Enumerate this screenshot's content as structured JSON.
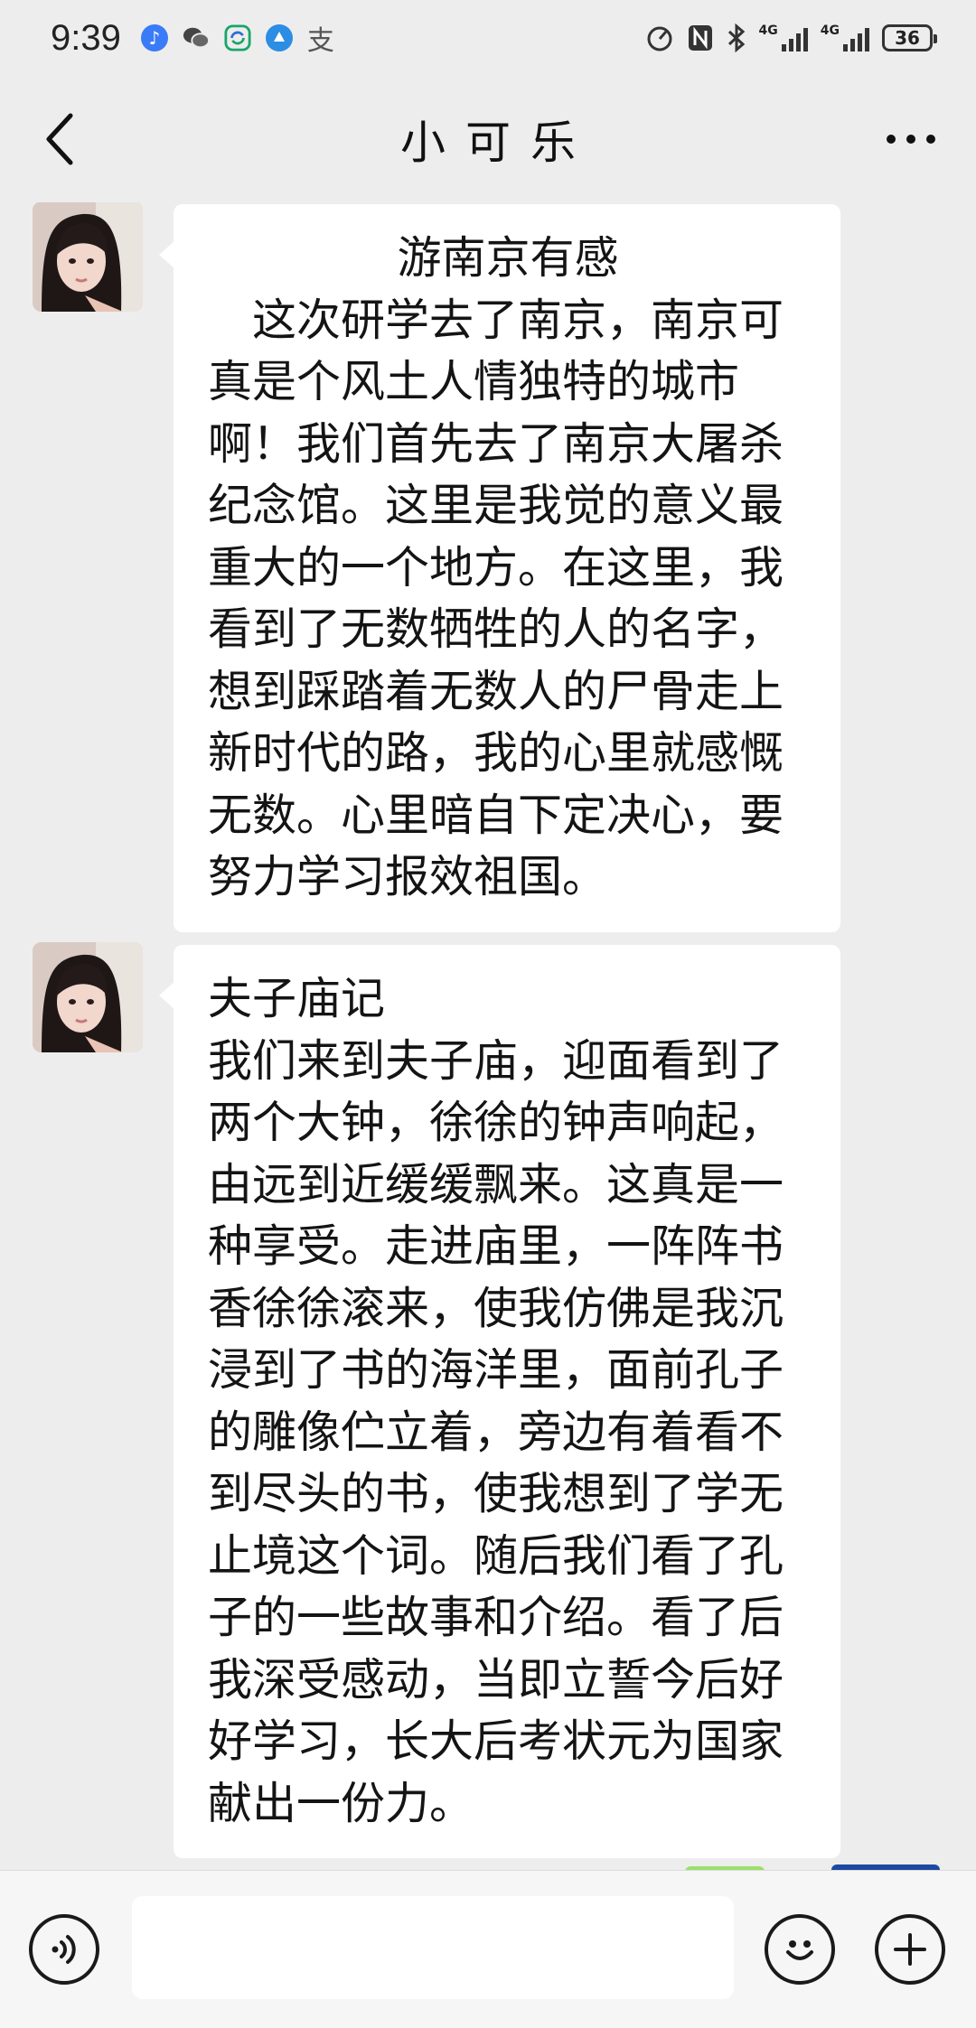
{
  "status_bar": {
    "time": "9:39",
    "apps": [
      {
        "icon": "music-app-icon",
        "color": "#3a7bf7",
        "glyph": "♪"
      },
      {
        "icon": "wechat-icon",
        "color": "#3c3c3c",
        "glyph": "●"
      },
      {
        "icon": "sync-app-icon",
        "color": "#19a56b",
        "glyph": "↻"
      },
      {
        "icon": "browser-app-icon",
        "color": "#2b8de3",
        "glyph": "◐"
      },
      {
        "icon": "alipay-icon",
        "color": "#555555",
        "glyph": "支"
      }
    ],
    "network_1": "4G",
    "network_2": "4G",
    "battery": "36"
  },
  "nav": {
    "title": "小可乐",
    "back_icon": "chevron-left-icon",
    "more_icon": "more-dots-icon"
  },
  "messages": [
    {
      "sender": "小可乐",
      "title": "游南京有感",
      "body": "　这次研学去了南京，南京可真是个风土人情独特的城市啊！我们首先去了南京大屠杀纪念馆。这里是我觉的意义最重大的一个地方。在这里，我看到了无数牺牲的人的名字，想到踩踏着无数人的尸骨走上新时代的路，我的心里就感慨无数。心里暗自下定决心，要努力学习报效祖国。"
    },
    {
      "sender": "小可乐",
      "title": "夫子庙记",
      "body": "我们来到夫子庙，迎面看到了两个大钟，徐徐的钟声响起，由远到近缓缓飘来。这真是一种享受。走进庙里，一阵阵书香徐徐滚来，使我仿佛是我沉浸到了书的海洋里，面前孔子的雕像伫立着，旁边有着看不到尽头的书，使我想到了学无止境这个词。随后我们看了孔子的一些故事和介绍。看了后我深受感动，当即立誓今后好好学习，长大后考状元为国家献出一份力。"
    }
  ],
  "input_bar": {
    "voice_icon": "voice-input-icon",
    "emoji_icon": "emoji-icon",
    "plus_icon": "plus-icon",
    "placeholder": ""
  },
  "colors": {
    "background": "#ededed",
    "bubble": "#ffffff",
    "input_bar": "#f6f6f6"
  }
}
